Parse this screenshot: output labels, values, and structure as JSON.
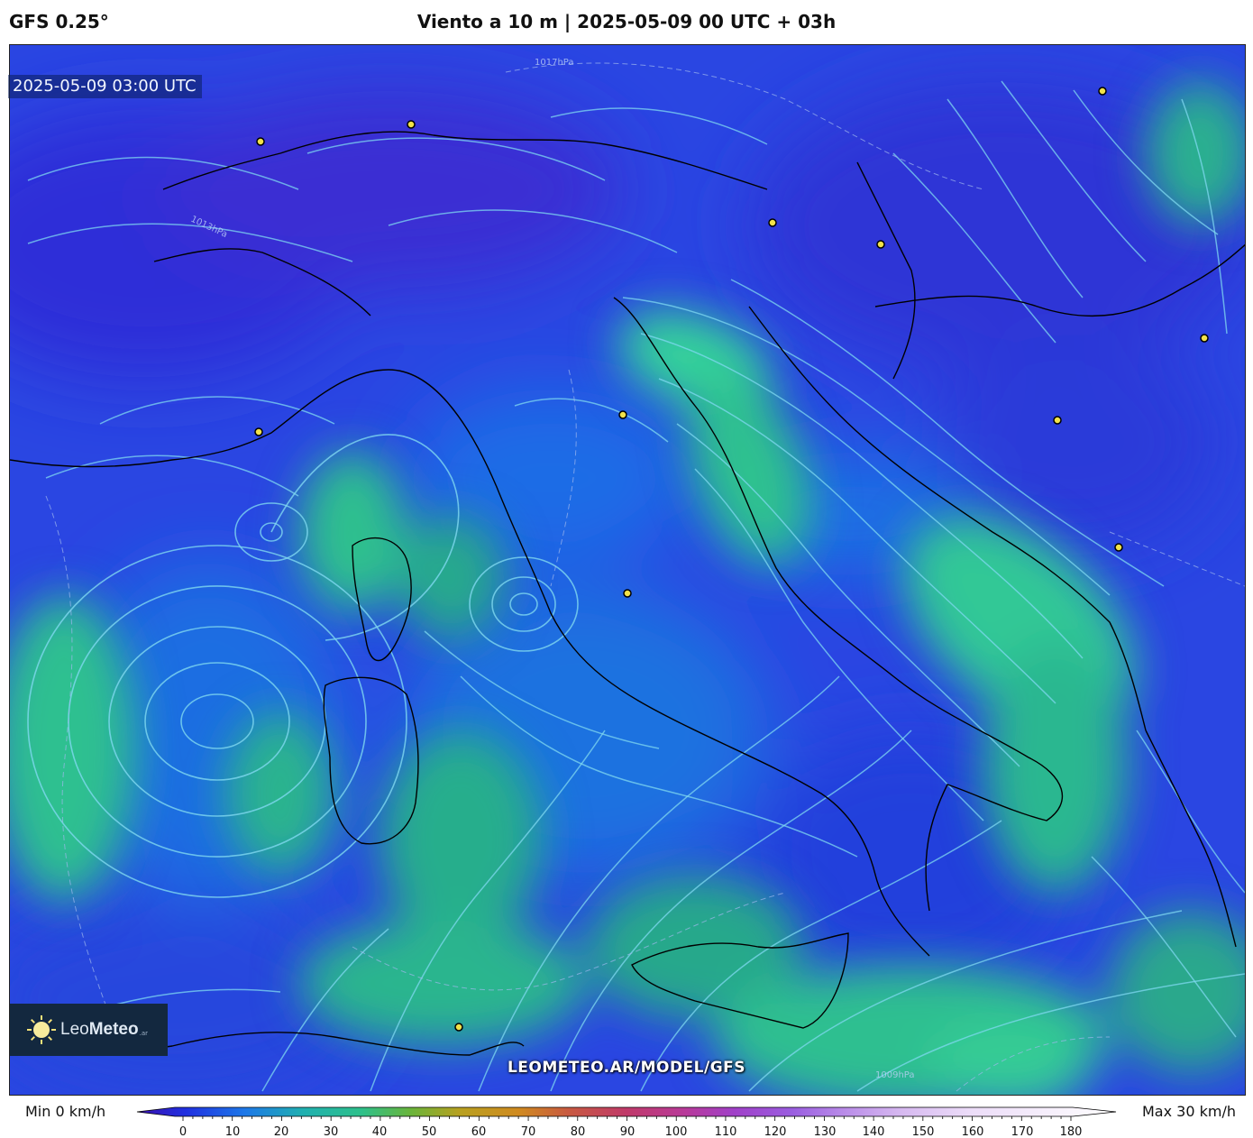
{
  "header": {
    "model": "GFS 0.25°",
    "title": "Viento a 10 m | 2025-05-09 00 UTC + 03h"
  },
  "map": {
    "valid_time": "2025-05-09 03:00 UTC",
    "watermark": "LEOMETEO.AR/MODEL/GFS",
    "isobar_labels": [
      "1017hPa",
      "1013hPa",
      "1009hPa"
    ],
    "colors": {
      "calm": "#2a3fe0",
      "light": "#1f6fe8",
      "moderate": "#2bbf8c",
      "streamline": "#7fd8f0",
      "coastline": "#000000",
      "city_marker": "#f2e24a"
    }
  },
  "logo": {
    "name_light": "Leo",
    "name_bold": "Meteo",
    "suffix": ".ar"
  },
  "colorbar": {
    "min_label": "Min 0 km/h",
    "max_label": "Max 30 km/h",
    "ticks": [
      "0",
      "10",
      "20",
      "30",
      "40",
      "50",
      "60",
      "70",
      "80",
      "90",
      "100",
      "110",
      "120",
      "130",
      "140",
      "150",
      "160",
      "170",
      "180"
    ],
    "unit": "km/h"
  }
}
